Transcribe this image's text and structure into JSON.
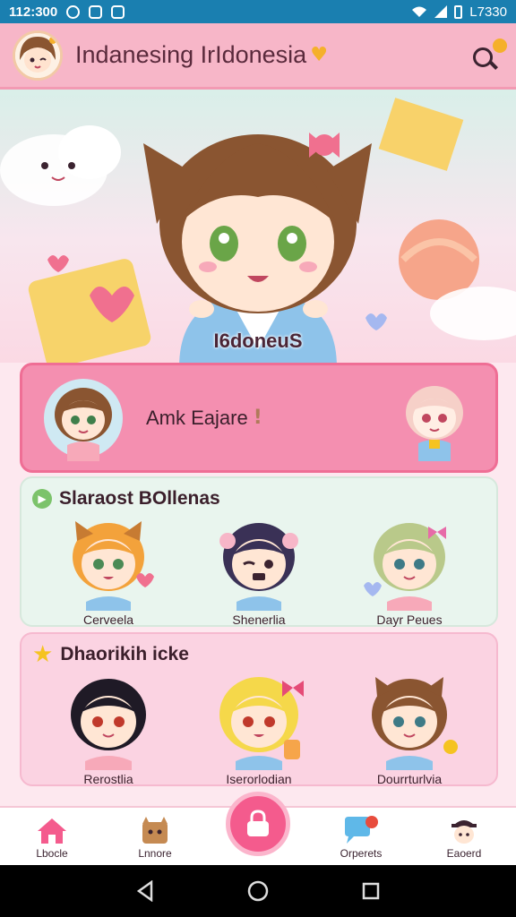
{
  "status_bar": {
    "time": "112:300",
    "right_text": "L7330"
  },
  "header": {
    "title": "Indanesing IrIdonesia"
  },
  "hero": {
    "label": "I6doneuS"
  },
  "featured": {
    "title": "Amk Eajare",
    "mark": "!"
  },
  "section_one": {
    "title": "Slaraost BOllenas",
    "characters": [
      {
        "name": "Cerveela",
        "hair": "#f3a23b"
      },
      {
        "name": "Shenerlia",
        "hair": "#3a3156"
      },
      {
        "name": "Dayr Peues",
        "hair": "#b9c98a"
      }
    ]
  },
  "section_two": {
    "title": "Dhaorikih icke",
    "characters": [
      {
        "name": "Rerostlia",
        "hair": "#1f1a26"
      },
      {
        "name": "Iserorlodian",
        "hair": "#f5d84a"
      },
      {
        "name": "Dourrturlvia",
        "hair": "#8a5531"
      }
    ]
  },
  "bottom_nav": [
    {
      "label": "Lbocle",
      "icon": "home-icon"
    },
    {
      "label": "Lnnore",
      "icon": "cat-icon"
    },
    {
      "label": "Orperets",
      "icon": "chat-icon"
    },
    {
      "label": "Eaoerd",
      "icon": "profile-icon"
    }
  ],
  "colors": {
    "accent": "#f45b8d",
    "header_bg": "#f7b6c8",
    "status_bg": "#1a7fb0"
  }
}
